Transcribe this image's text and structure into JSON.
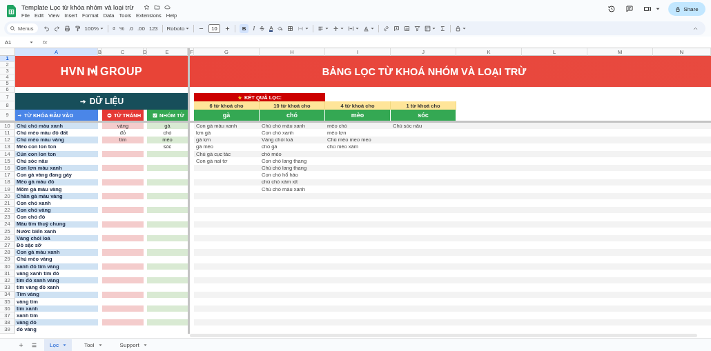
{
  "app": {
    "title": "Template Lọc từ khóa nhóm và loại trừ",
    "menu": [
      "File",
      "Edit",
      "View",
      "Insert",
      "Format",
      "Data",
      "Tools",
      "Extensions",
      "Help"
    ],
    "share": "Share"
  },
  "toolbar": {
    "search": "Menus",
    "zoom": "100%",
    "currency": "₫",
    "percent": "%",
    "decrease_decimal": ".0",
    "increase_decimal": ".00",
    "number_format": "123",
    "font": "Roboto",
    "font_size": "10",
    "bold": "B",
    "bold_selected": true,
    "italic": "I",
    "text_color": "A"
  },
  "formula_bar": {
    "cell": "A1",
    "fx": "fx"
  },
  "columns": [
    {
      "label": "A",
      "selected": true
    },
    {
      "label": "B",
      "selected": false
    },
    {
      "label": "C",
      "selected": false
    },
    {
      "label": "D",
      "selected": false
    },
    {
      "label": "E",
      "selected": false
    },
    {
      "label": "F",
      "selected": false
    },
    {
      "label": "G",
      "selected": false
    },
    {
      "label": "H",
      "selected": false
    },
    {
      "label": "I",
      "selected": false
    },
    {
      "label": "J",
      "selected": false
    },
    {
      "label": "K",
      "selected": false
    },
    {
      "label": "L",
      "selected": false
    },
    {
      "label": "M",
      "selected": false
    },
    {
      "label": "N",
      "selected": false
    }
  ],
  "row_numbers": [
    {
      "label": "1",
      "selected": true
    },
    {
      "label": "2",
      "selected": false
    },
    {
      "label": "3",
      "selected": false
    },
    {
      "label": "4",
      "selected": false
    },
    {
      "label": "5",
      "selected": false
    },
    {
      "label": "6",
      "selected": false
    },
    {
      "label": "7",
      "selected": false
    },
    {
      "label": "8",
      "selected": false
    },
    {
      "label": "9",
      "selected": false
    }
  ],
  "logo": {
    "left": "HVN",
    "right": "GROUP"
  },
  "title": "BẢNG LỌC TỪ KHOÁ NHÓM VÀ LOẠI TRỪ",
  "data_header": "DỮ LIỆU",
  "input_header": "TỪ KHÓA ĐẦU VÀO",
  "avoid_header": "TỪ TRÁNH",
  "group_header": "NHÓM TỪ",
  "result_header": "KẾT QUẢ LỌC:",
  "groups": [
    {
      "count": "6 từ khoá cho",
      "word": "gà",
      "results": [
        "Con gà màu xanh",
        "lợn gà",
        "gà lợn",
        "gà mèo",
        "Chú gà cục tác",
        "Con gà nai tơ"
      ]
    },
    {
      "count": "10 từ khoá cho",
      "word": "chó",
      "results": [
        "Chú chó màu xanh",
        "Con chó xanh",
        "Vàng chói loá",
        "chó gà",
        "chó mèo",
        "Con chó lang thang",
        "Chú chó lang thang",
        "Con chó hổ háo",
        "chú chó xám xịt",
        "Chú chó màu xanh"
      ]
    },
    {
      "count": "4 từ khoá cho",
      "word": "mèo",
      "results": [
        "mèo chó",
        "mèo lợn",
        "Chú mèo meo meo",
        "chú mèo xám"
      ]
    },
    {
      "count": "1 từ khoá cho",
      "word": "sóc",
      "results": [
        "Chú sóc nâu"
      ]
    }
  ],
  "rows": [
    {
      "num": "10",
      "keyword": "Chú chó màu xanh",
      "avoid": "vàng",
      "group": "gà"
    },
    {
      "num": "11",
      "keyword": "Chú mèo màu đỏ đất",
      "avoid": "đỏ",
      "group": "chó"
    },
    {
      "num": "12",
      "keyword": "Chú mèo màu vàng",
      "avoid": "tím",
      "group": "mèo"
    },
    {
      "num": "13",
      "keyword": "Mèo con lon ton",
      "group": "sóc"
    },
    {
      "num": "14",
      "keyword": "Cún con lon ton"
    },
    {
      "num": "15",
      "keyword": "Chú sóc nâu"
    },
    {
      "num": "16",
      "keyword": "Con lợn màu xanh"
    },
    {
      "num": "17",
      "keyword": "Con gà vàng đang gáy"
    },
    {
      "num": "18",
      "keyword": "Mèo gà màu đỏ"
    },
    {
      "num": "19",
      "keyword": "Mõm gà màu vàng"
    },
    {
      "num": "20",
      "keyword": "Chân gà màu vàng"
    },
    {
      "num": "21",
      "keyword": "Con chó xanh"
    },
    {
      "num": "22",
      "keyword": "Con chó vàng"
    },
    {
      "num": "23",
      "keyword": "Con chó đỏ"
    },
    {
      "num": "24",
      "keyword": "Màu tím thuỷ chung"
    },
    {
      "num": "25",
      "keyword": "Nước biển xanh"
    },
    {
      "num": "26",
      "keyword": "Vàng chói loá"
    },
    {
      "num": "27",
      "keyword": "Đỏ sặc sỡ"
    },
    {
      "num": "28",
      "keyword": "Con gà màu xanh"
    },
    {
      "num": "29",
      "keyword": "Chú mèo vàng"
    },
    {
      "num": "30",
      "keyword": "xanh đỏ tím vàng"
    },
    {
      "num": "31",
      "keyword": "vàng xanh tím đỏ"
    },
    {
      "num": "32",
      "keyword": "tím đỏ xanh vàng"
    },
    {
      "num": "33",
      "keyword": "tím vàng đỏ xanh"
    },
    {
      "num": "34",
      "keyword": "Tím vàng"
    },
    {
      "num": "35",
      "keyword": "vàng tím"
    },
    {
      "num": "36",
      "keyword": "tím xanh"
    },
    {
      "num": "37",
      "keyword": "xanh tím"
    },
    {
      "num": "38",
      "keyword": "vàng đỏ"
    },
    {
      "num": "39",
      "keyword": "đỏ vàng"
    }
  ],
  "sheets": [
    {
      "label": "Lọc",
      "selected": true
    },
    {
      "label": "Tool",
      "selected": false
    },
    {
      "label": "Support",
      "selected": false
    }
  ]
}
